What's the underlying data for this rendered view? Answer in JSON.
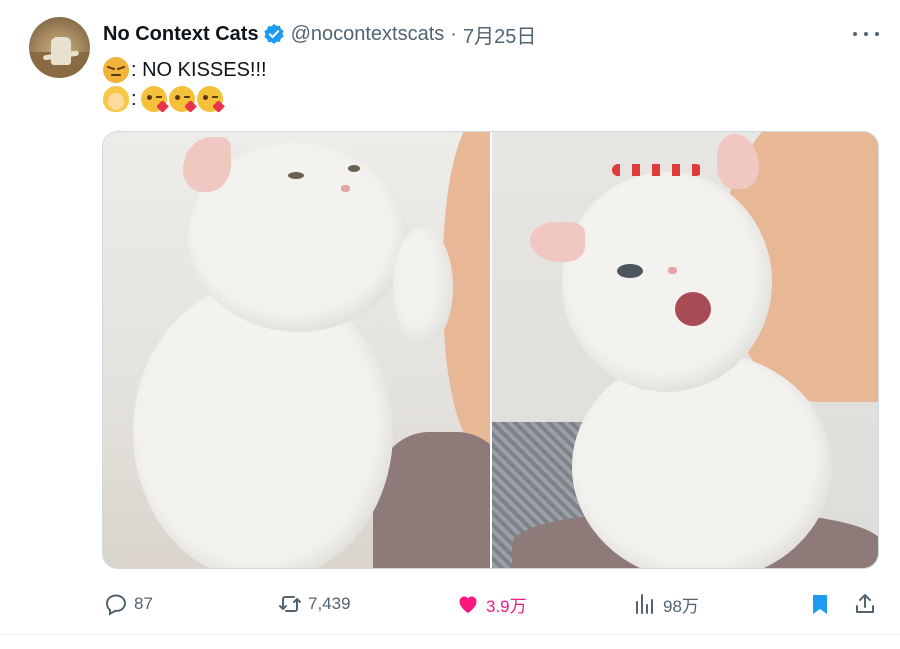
{
  "tweet": {
    "author_name": "No Context Cats",
    "handle": "@nocontextscats",
    "separator": "·",
    "date": "7月25日",
    "line1_emoji": "pouting-cat-emoji",
    "line1_text": ": NO KISSES!!!",
    "line2_emoji": "woman-emoji",
    "line2_sep": ":",
    "line2_emojis": [
      "kissing-heart-emoji",
      "kissing-heart-emoji",
      "kissing-heart-emoji"
    ]
  },
  "media": {
    "count": 2,
    "images": [
      {
        "name": "photo-cat-raising-paw"
      },
      {
        "name": "photo-cat-biting-face"
      }
    ]
  },
  "actions": {
    "replies": "87",
    "retweets": "7,439",
    "likes": "3.9万",
    "views": "98万"
  },
  "icons": {
    "verified": "verified-badge-icon",
    "more": "more-icon",
    "reply": "reply-icon",
    "retweet": "retweet-icon",
    "like": "heart-icon",
    "views": "views-icon",
    "bookmark": "bookmark-icon",
    "share": "share-icon"
  },
  "colors": {
    "verified": "#1d9bf0",
    "like": "#f91880",
    "bookmark": "#1d9bf0",
    "secondary_text": "#536471"
  }
}
